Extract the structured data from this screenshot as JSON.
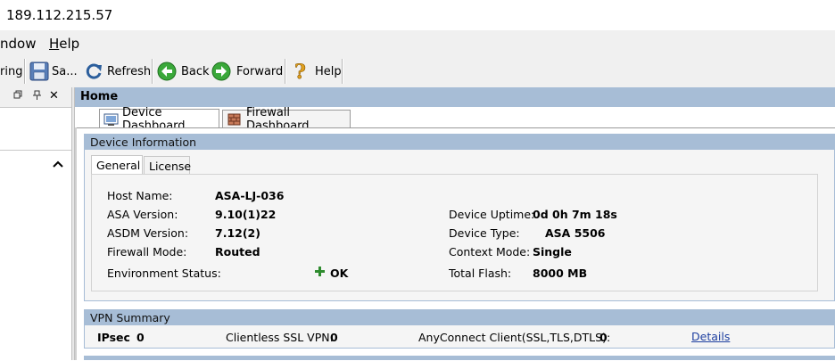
{
  "window": {
    "title": "189.112.215.57"
  },
  "menu": {
    "items": [
      "ndow",
      "Help"
    ]
  },
  "toolbar": {
    "items": [
      {
        "label": "ring",
        "icon": "monitoring-icon"
      },
      {
        "label": "Sa...",
        "icon": "save-icon"
      },
      {
        "label": "Refresh",
        "icon": "refresh-icon"
      },
      {
        "label": "Back",
        "icon": "back-arrow-icon"
      },
      {
        "label": "Forward",
        "icon": "forward-arrow-icon"
      },
      {
        "label": "Help",
        "icon": "help-icon"
      }
    ]
  },
  "left_pane": {
    "header_icons": [
      "restore-icon",
      "pin-icon",
      "close-icon"
    ],
    "scroll_icon": "chevron-up-icon"
  },
  "home": {
    "title": "Home",
    "tabs": [
      {
        "label": "Device Dashboard",
        "icon": "dashboard-icon",
        "active": true
      },
      {
        "label": "Firewall Dashboard",
        "icon": "firewall-icon",
        "active": false
      }
    ]
  },
  "device_info": {
    "title": "Device Information",
    "tabs": [
      {
        "label": "General",
        "active": true
      },
      {
        "label": "License",
        "active": false
      }
    ],
    "left_fields": [
      {
        "label": "Host Name:",
        "value": "ASA-LJ-036"
      },
      {
        "label": "ASA Version:",
        "value": "9.10(1)22"
      },
      {
        "label": "ASDM Version:",
        "value": "7.12(2)"
      },
      {
        "label": "Firewall Mode:",
        "value": "Routed"
      },
      {
        "label": "Environment Status:",
        "value": "OK"
      }
    ],
    "right_fields": [
      {
        "label": "Device Uptime:",
        "value": "0d 0h 7m 18s"
      },
      {
        "label": "Device Type:",
        "value": "ASA 5506"
      },
      {
        "label": "Context Mode:",
        "value": "Single"
      },
      {
        "label": "Total Flash:",
        "value": "8000 MB"
      }
    ]
  },
  "vpn_summary": {
    "title": "VPN Summary",
    "ipsec_label": "IPsec",
    "ipsec_value": "0",
    "clientless_label": "Clientless SSL VPN:",
    "clientless_value": "0",
    "anyconnect_label": "AnyConnect Client(SSL,TLS,DTLS):",
    "anyconnect_value": "0",
    "details_link": "Details"
  },
  "colors": {
    "panel_header": "#a7bdd6",
    "link": "#1e3fa0",
    "status_ok": "#2e8b2e"
  }
}
